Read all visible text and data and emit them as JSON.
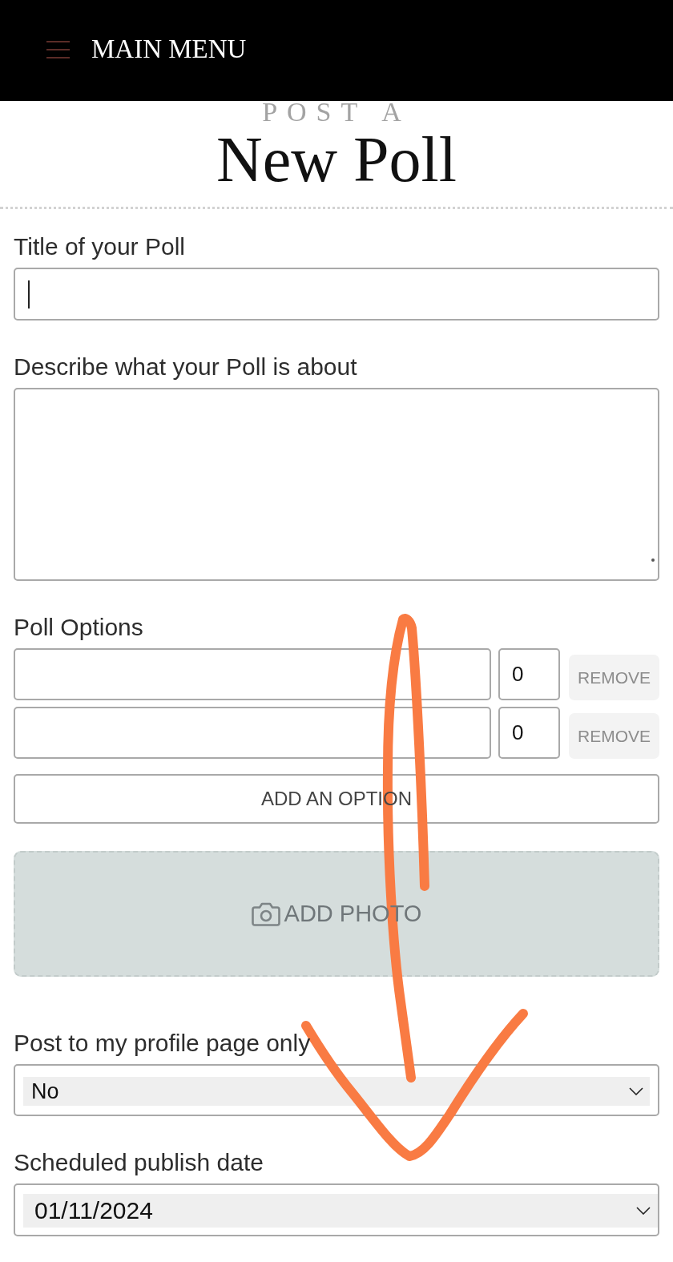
{
  "header": {
    "menu_label": "MAIN MENU"
  },
  "heading": {
    "kicker": "POST A",
    "title": "New Poll"
  },
  "form": [
    {
      "kind": "text",
      "label": "Title of your Poll",
      "focused": true
    },
    {
      "kind": "textarea",
      "label": "Describe what your Poll is about"
    },
    {
      "kind": "options",
      "label": "Poll Options",
      "options": [
        {
          "count": "0",
          "remove_label": "REMOVE",
          "remove_disabled": true
        },
        {
          "count": "0",
          "remove_label": "REMOVE",
          "remove_disabled": true
        }
      ],
      "add_label": "ADD AN OPTION"
    },
    {
      "kind": "photo",
      "text": "ADD PHOTO"
    },
    {
      "kind": "select",
      "label": "Post to my profile page only",
      "value": "No"
    },
    {
      "kind": "date",
      "label": "Scheduled publish date",
      "value": "01/11/2024"
    }
  ]
}
